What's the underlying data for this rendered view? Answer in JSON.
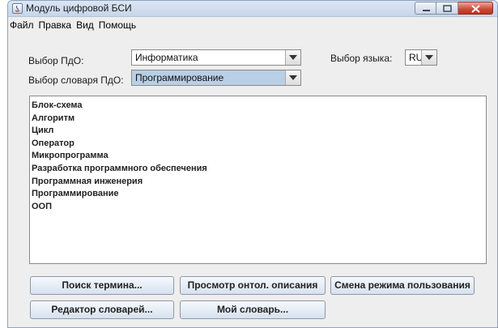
{
  "window": {
    "title": "Модуль цифровой БСИ",
    "close_color": "#c94a35"
  },
  "menu": [
    "Файл",
    "Правка",
    "Вид",
    "Помощь"
  ],
  "form": {
    "subject_label": "Выбор ПдО:",
    "subject_value": "Информатика",
    "dictionary_label": "Выбор словаря ПдО:",
    "dictionary_value": "Программирование",
    "language_label": "Выбор языка:",
    "language_value": "RU"
  },
  "terms": [
    "Блок-схема",
    "Алгоритм",
    "Цикл",
    "Оператор",
    "Микропрограмма",
    "Разработка программного обеспечения",
    "Программная инженерия",
    "Программирование",
    "ООП"
  ],
  "buttons": {
    "search": "Поиск термина...",
    "view_description": "Просмотр онтол. описания",
    "change_mode": "Смена режима пользования",
    "dictionary_editor": "Редактор словарей...",
    "my_dictionary": "Мой словарь..."
  }
}
